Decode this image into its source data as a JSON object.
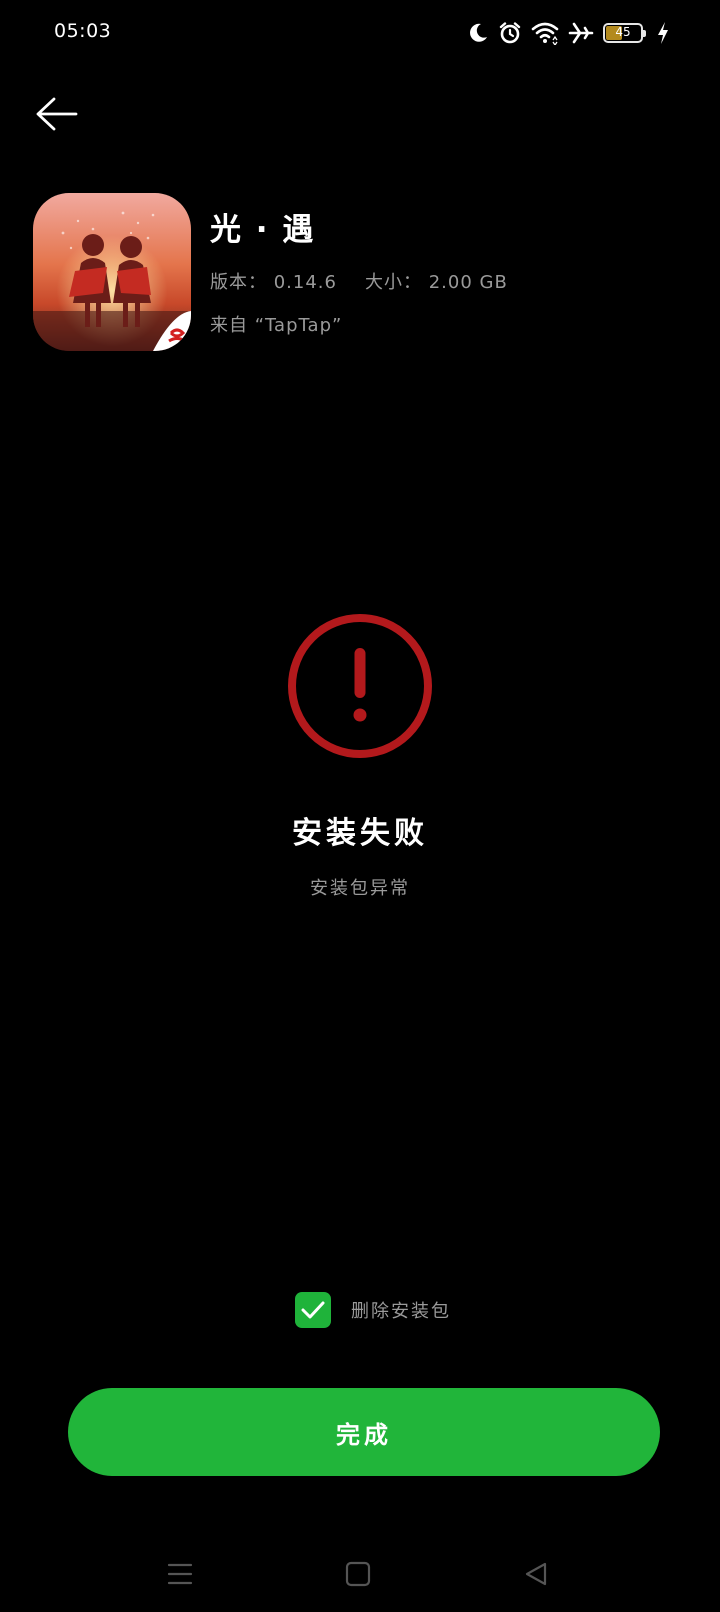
{
  "status_bar": {
    "time": "05:03",
    "battery_level": "45",
    "icons": [
      "moon-icon",
      "alarm-icon",
      "wifi-icon",
      "airplane-icon",
      "battery-icon",
      "charging-icon"
    ]
  },
  "app": {
    "name": "光 · 遇",
    "version": "版本： 0.14.6",
    "size": "大小： 2.00 GB",
    "source": "来自 “TapTap”"
  },
  "result": {
    "title": "安装失败",
    "message": "安装包异常",
    "icon": "alert-circle-icon"
  },
  "options": {
    "delete_package_label": "删除安装包",
    "delete_package_checked": true
  },
  "actions": {
    "done_label": "完成"
  },
  "colors": {
    "background": "#000000",
    "accent_green": "#21b53a",
    "error_red": "#b3191c",
    "secondary_text": "#9a9a9a"
  }
}
